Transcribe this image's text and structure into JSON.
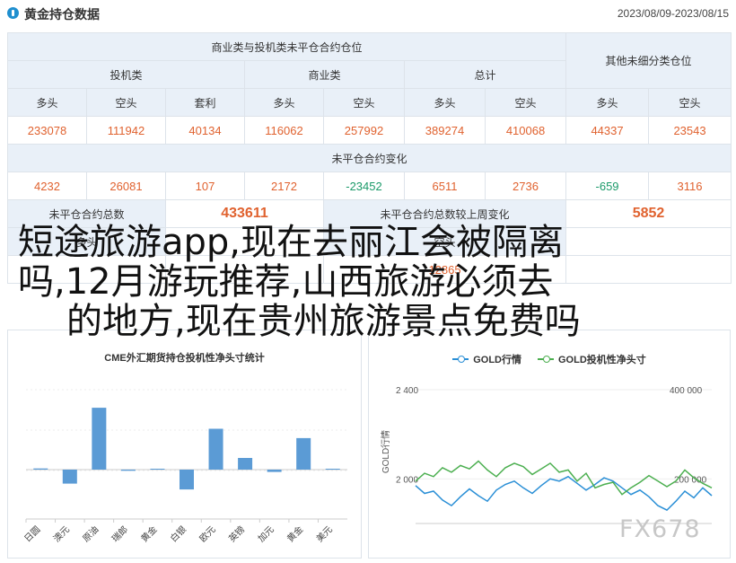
{
  "header": {
    "title": "黄金持仓数据",
    "date_range": "2023/08/09-2023/08/15"
  },
  "positions": {
    "group_title": "商业类与投机类未平仓合约仓位",
    "other_title": "其他未细分类仓位",
    "speculative_label": "投机类",
    "commercial_label": "商业类",
    "total_label": "总计",
    "long_label": "多头",
    "short_label": "空头",
    "spread_label": "套利",
    "speculative": {
      "long": "233078",
      "short": "111942",
      "spread": "40134"
    },
    "commercial": {
      "long": "116062",
      "short": "257992"
    },
    "total": {
      "long": "389274",
      "short": "410068"
    },
    "other": {
      "long": "44337",
      "short": "23543"
    },
    "change_title": "未平仓合约变化",
    "changes": [
      "4232",
      "26081",
      "107",
      "2172",
      "-23452",
      "6511",
      "2736",
      "-659",
      "3116"
    ],
    "oi_total_label": "未平仓合约总数",
    "oi_total": "433611",
    "oi_change_label": "未平仓合约总数较上周变化",
    "oi_change": "5852"
  },
  "overlay": {
    "line1": "短途旅游app,现在去丽江会被隔离",
    "line2": "吗,12月游玩推荐,山西旅游必须去",
    "line3": "的地方,现在贵州旅游景点免费吗"
  },
  "hidden_row": {
    "label_left": "多头",
    "label_right": "空头",
    "value": "12865"
  },
  "watermark": "FX678",
  "cme_chart": {
    "title": "CME外汇期货持仓投机性净头寸统计",
    "bar_color": "#5b9bd5"
  },
  "gold_chart": {
    "legend_gold": "GOLD行情",
    "legend_net": "GOLD投机性净头寸",
    "color_gold": "#2a8fd6",
    "color_net": "#4caf50",
    "ylabel_left": "GOLD行情"
  },
  "chart_data": [
    {
      "type": "bar",
      "title": "CME外汇期货持仓投机性净头寸统计",
      "categories": [
        "日圆",
        "澳元",
        "原油",
        "瑞郎",
        "黄金",
        "白银",
        "欧元",
        "英镑",
        "加元",
        "黄金",
        "美元"
      ],
      "values": [
        1,
        -12,
        53,
        -1,
        0,
        -17,
        35,
        10,
        -2,
        27,
        0
      ]
    },
    {
      "type": "line",
      "series": [
        {
          "name": "GOLD行情",
          "values": [
            1970,
            1935,
            1945,
            1905,
            1880,
            1920,
            1955,
            1925,
            1900,
            1950,
            1975,
            1990,
            1960,
            1935,
            1970,
            2000,
            1990,
            2010,
            1980,
            1950,
            1975,
            2005,
            1990,
            1960,
            1930,
            1950,
            1920,
            1880,
            1860,
            1900,
            1945,
            1915,
            1960,
            1925
          ]
        },
        {
          "name": "GOLD投机性净头寸",
          "values": [
            1990,
            2025,
            2010,
            2050,
            2030,
            2060,
            2045,
            2080,
            2040,
            2010,
            2050,
            2070,
            2055,
            2020,
            2045,
            2070,
            2030,
            2040,
            1990,
            2025,
            1960,
            1975,
            1985,
            1930,
            1960,
            1985,
            2015,
            1990,
            1965,
            1990,
            2040,
            2005,
            1980,
            1960
          ]
        }
      ],
      "ylim": [
        1800,
        2400
      ],
      "ticks_left": [
        "2 400",
        "2 000"
      ],
      "ticks_right": [
        "400 000",
        "200 000"
      ]
    }
  ]
}
